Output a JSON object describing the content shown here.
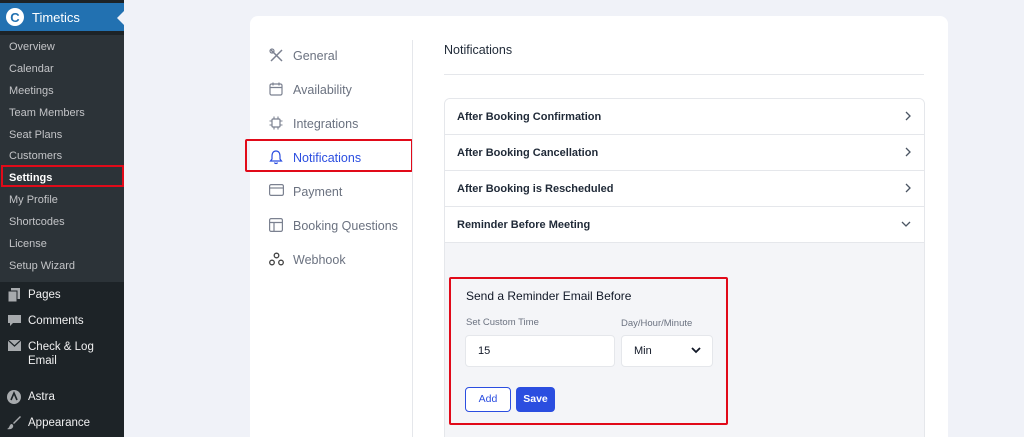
{
  "plugin": {
    "name": "Timetics",
    "logo_letter": "C"
  },
  "submenu": [
    "Overview",
    "Calendar",
    "Meetings",
    "Team Members",
    "Seat Plans",
    "Customers",
    "Settings",
    "My Profile",
    "Shortcodes",
    "License",
    "Setup Wizard"
  ],
  "wp_menu": {
    "pages": "Pages",
    "comments": "Comments",
    "check_log_line1": "Check & Log",
    "check_log_line2": "Email",
    "astra": "Astra",
    "appearance": "Appearance"
  },
  "tabs": {
    "general": "General",
    "availability": "Availability",
    "integrations": "Integrations",
    "notifications": "Notifications",
    "payment": "Payment",
    "booking_questions": "Booking Questions",
    "webhook": "Webhook"
  },
  "content": {
    "title": "Notifications",
    "accordion": {
      "after_confirmation": "After Booking Confirmation",
      "after_cancellation": "After Booking Cancellation",
      "after_rescheduled": "After Booking is Rescheduled",
      "reminder": "Reminder Before Meeting"
    },
    "reminder_form": {
      "title": "Send a Reminder Email Before",
      "custom_time_label": "Set Custom Time",
      "unit_label": "Day/Hour/Minute",
      "custom_time_value": "15",
      "unit_value": "Min",
      "add_label": "Add",
      "save_label": "Save"
    }
  },
  "colors": {
    "accent": "#2b4ee0",
    "highlight": "#e10a19",
    "wp_blue": "#2271b1"
  }
}
